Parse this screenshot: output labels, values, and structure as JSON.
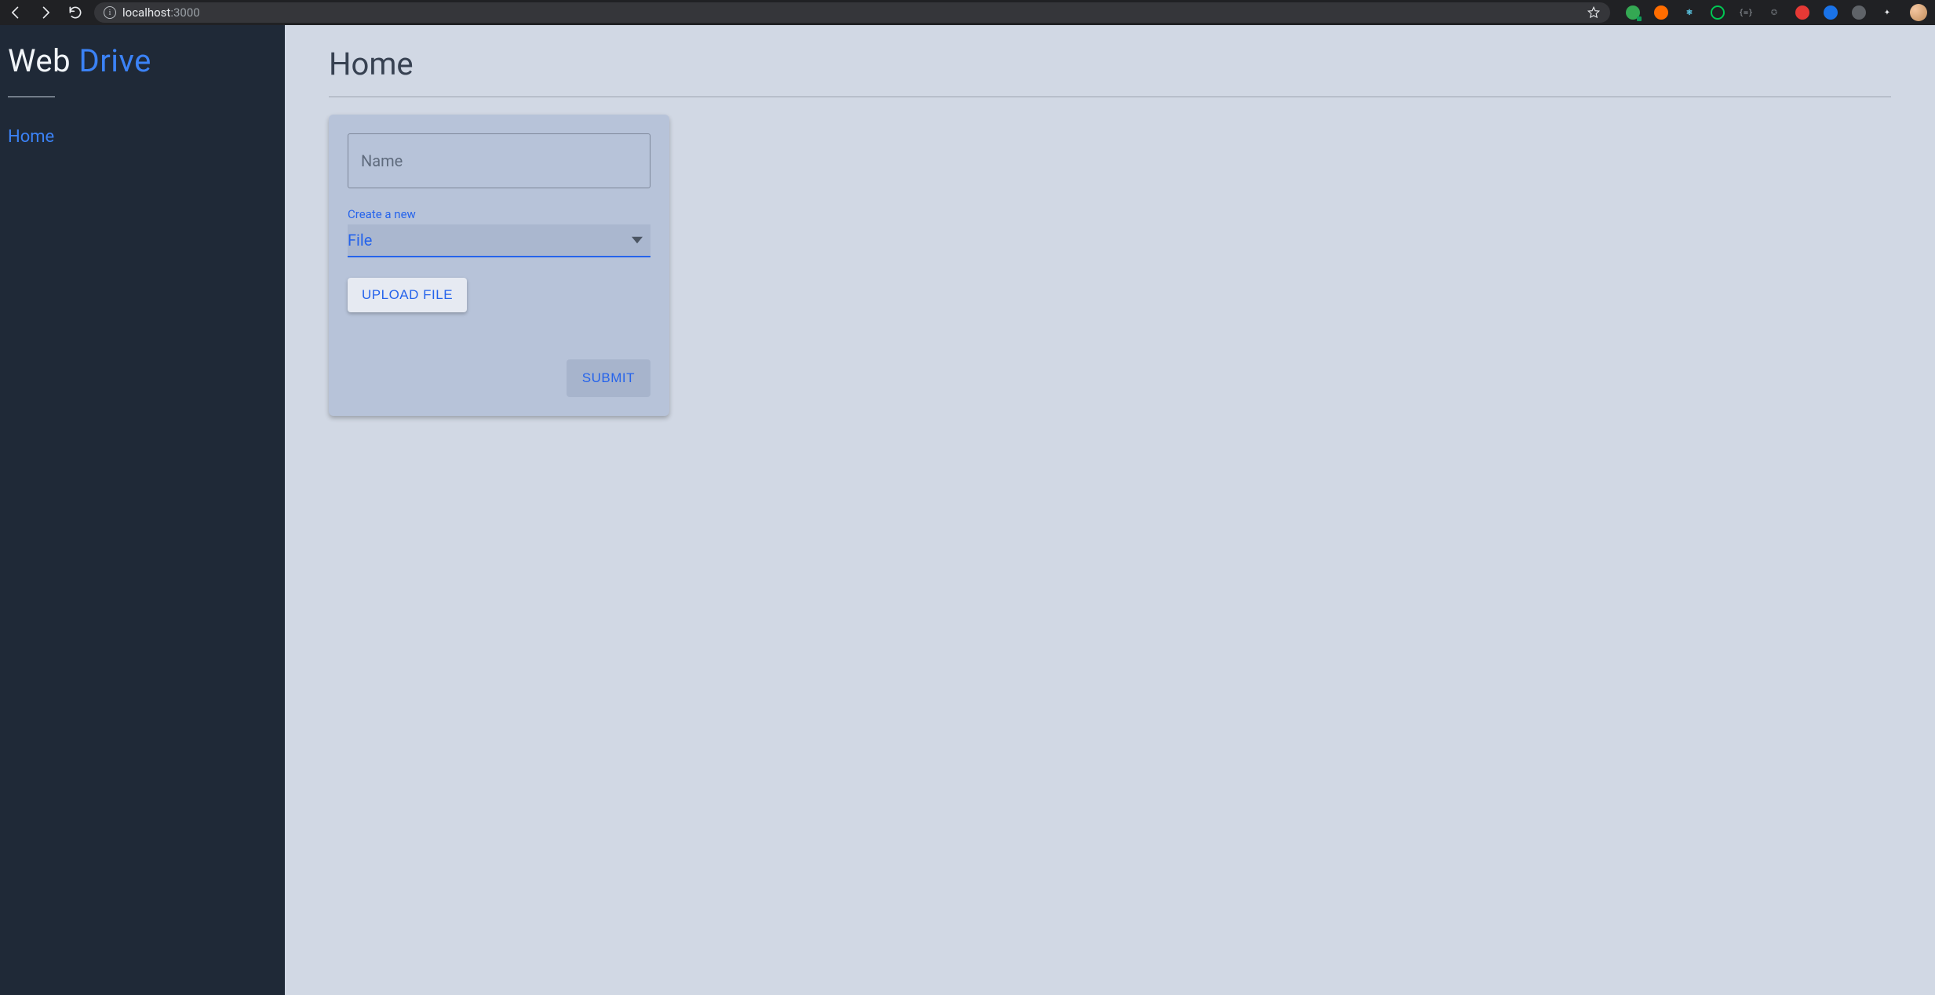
{
  "browser": {
    "url_host": "localhost",
    "url_port": ":3000"
  },
  "sidebar": {
    "logo_word1": "Web ",
    "logo_word2": "Drive",
    "nav": [
      {
        "label": "Home"
      }
    ]
  },
  "main": {
    "title": "Home",
    "form": {
      "name_label": "Name",
      "name_value": "",
      "create_label": "Create a new",
      "create_value": "File",
      "upload_label": "UPLOAD FILE",
      "submit_label": "SUBMIT"
    }
  }
}
